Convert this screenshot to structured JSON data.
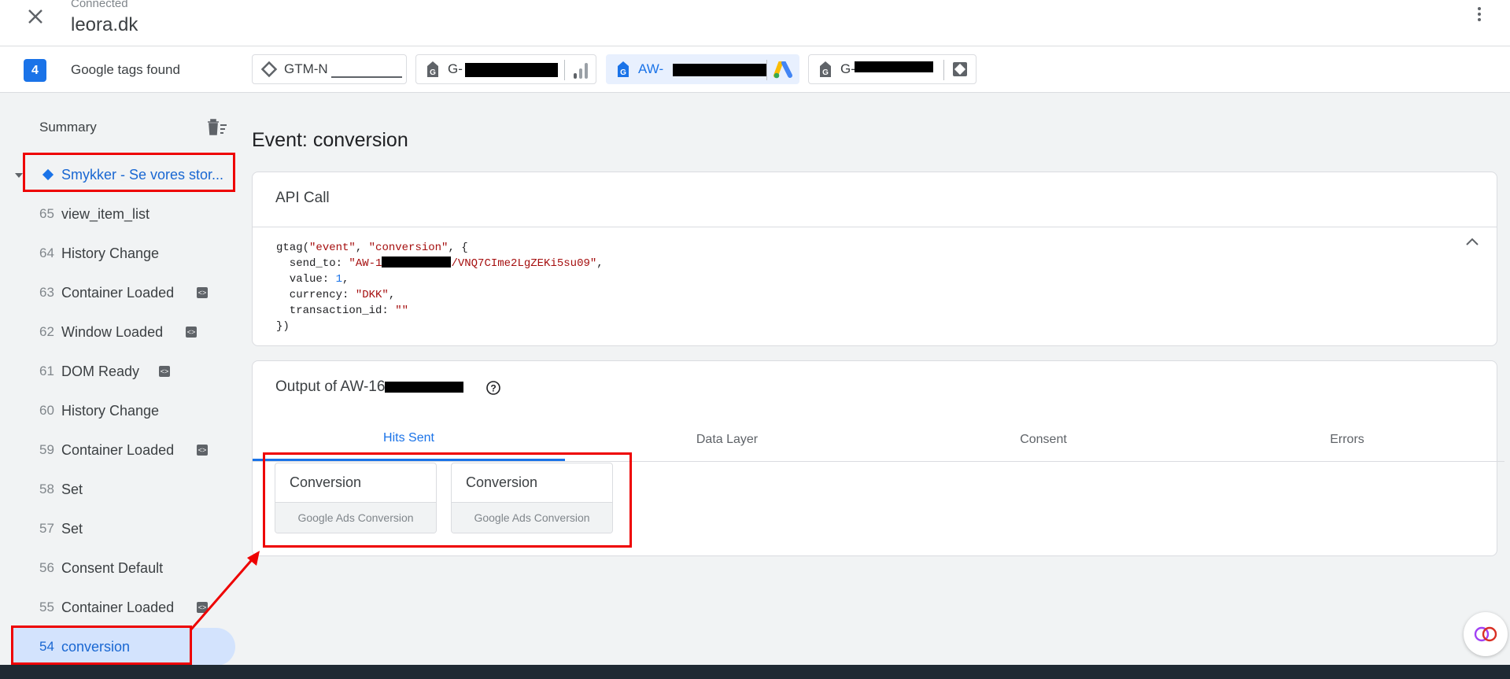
{
  "header": {
    "status": "Connected",
    "site": "leora.dk"
  },
  "tags_bar": {
    "count": "4",
    "label": "Google tags found",
    "chips": [
      {
        "label": "GTM-N",
        "icon": "gtm-diamond-icon"
      },
      {
        "label": "G-",
        "icon": "google-tag-icon",
        "product_icon": "analytics-icon"
      },
      {
        "label": "AW-",
        "icon": "google-tag-icon",
        "product_icon": "google-ads-icon"
      },
      {
        "label": "G-",
        "icon": "google-tag-icon",
        "product_icon": "tag-manager-icon"
      }
    ]
  },
  "sidebar": {
    "summary": "Summary",
    "page": "Smykker - Se vores stor...",
    "events": [
      {
        "num": "65",
        "label": "view_item_list",
        "badge": false
      },
      {
        "num": "64",
        "label": "History Change",
        "badge": false
      },
      {
        "num": "63",
        "label": "Container Loaded",
        "badge": true
      },
      {
        "num": "62",
        "label": "Window Loaded",
        "badge": true
      },
      {
        "num": "61",
        "label": "DOM Ready",
        "badge": true
      },
      {
        "num": "60",
        "label": "History Change",
        "badge": false
      },
      {
        "num": "59",
        "label": "Container Loaded",
        "badge": true
      },
      {
        "num": "58",
        "label": "Set",
        "badge": false
      },
      {
        "num": "57",
        "label": "Set",
        "badge": false
      },
      {
        "num": "56",
        "label": "Consent Default",
        "badge": false
      },
      {
        "num": "55",
        "label": "Container Loaded",
        "badge": true
      },
      {
        "num": "54",
        "label": "conversion",
        "badge": false
      }
    ]
  },
  "main": {
    "event_title": "Event: conversion",
    "api_card": {
      "title": "API Call",
      "code": {
        "fn": "gtag(",
        "arg1": "\"event\"",
        "arg2": "\"conversion\"",
        "send_to_key": "  send_to: ",
        "send_to_pre": "\"AW-1",
        "send_to_post": "/VNQ7CIme2LgZEKi5su09\"",
        "value_key": "  value: ",
        "value": "1",
        "currency_key": "  currency: ",
        "currency": "\"DKK\"",
        "txn_key": "  transaction_id: ",
        "txn": "\"\"",
        "close": "})"
      }
    },
    "output_card": {
      "title": "Output of AW-16",
      "tabs": [
        "Hits Sent",
        "Data Layer",
        "Consent",
        "Errors"
      ],
      "hits": [
        {
          "title": "Conversion",
          "type": "Google Ads Conversion"
        },
        {
          "title": "Conversion",
          "type": "Google Ads Conversion"
        }
      ]
    }
  },
  "colors": {
    "accent": "#1a73e8",
    "highlight": "#ee0000",
    "selected_bg": "#d3e3fd"
  }
}
